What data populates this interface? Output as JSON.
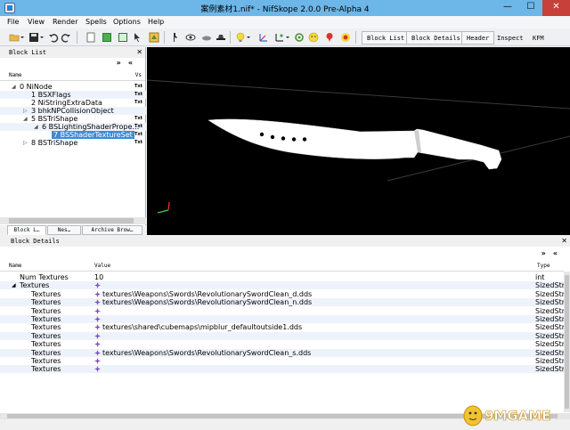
{
  "window": {
    "title": "案例素材1.nif* - NifSkope 2.0.0 Pre-Alpha 4",
    "minimize": "—",
    "maximize": "☐",
    "close": "✕"
  },
  "menu": [
    "File",
    "View",
    "Render",
    "Spells",
    "Options",
    "Help"
  ],
  "toolbar": {
    "tabs": [
      "Block List",
      "Block Details",
      "Header",
      "Inspect",
      "KFM"
    ]
  },
  "block_list": {
    "title": "Block List",
    "col_name": "Name",
    "col_version": "Vs",
    "rows": [
      {
        "label": "0 NiNode",
        "version": "Txt",
        "arrow": "◢"
      },
      {
        "label": "1 BSXFlags",
        "version": "Txt",
        "arrow": ""
      },
      {
        "label": "2 NiStringExtraData",
        "version": "Txt",
        "arrow": ""
      },
      {
        "label": "3 bhkNPCollisionObject",
        "version": "",
        "arrow": "▷"
      },
      {
        "label": "5 BSTriShape",
        "version": "Txt",
        "arrow": "◢"
      },
      {
        "label": "6 BSLightingShaderPrope…",
        "version": "Txt",
        "arrow": "◢"
      },
      {
        "label": "7 BSShaderTextureSet",
        "version": "Txt",
        "arrow": ""
      },
      {
        "label": "8 BSTriShape",
        "version": "Txt",
        "arrow": "▷"
      }
    ],
    "tabs": [
      "Block L…",
      "Nes…",
      "Archive Brow…"
    ]
  },
  "block_details": {
    "title": "Block Details",
    "col_name": "Name",
    "col_value": "Value",
    "col_type": "Type",
    "rows": [
      {
        "name": "Num Textures",
        "value": "10",
        "type": "int",
        "indent": 0,
        "icon": false
      },
      {
        "name": "Textures",
        "value": "",
        "type": "SizedStr",
        "indent": 0,
        "icon": true,
        "arrow": "◢"
      },
      {
        "name": "Textures",
        "value": "textures\\Weapons\\Swords\\RevolutionarySwordClean_d.dds",
        "type": "SizedStr",
        "indent": 1,
        "icon": true
      },
      {
        "name": "Textures",
        "value": "textures\\Weapons\\Swords\\RevolutionarySwordClean_n.dds",
        "type": "SizedStr",
        "indent": 1,
        "icon": true
      },
      {
        "name": "Textures",
        "value": "",
        "type": "SizedStr",
        "indent": 1,
        "icon": true
      },
      {
        "name": "Textures",
        "value": "",
        "type": "SizedStr",
        "indent": 1,
        "icon": true
      },
      {
        "name": "Textures",
        "value": "textures\\shared\\cubemaps\\mipblur_defaultoutside1.dds",
        "type": "SizedStr",
        "indent": 1,
        "icon": true
      },
      {
        "name": "Textures",
        "value": "",
        "type": "SizedStr",
        "indent": 1,
        "icon": true
      },
      {
        "name": "Textures",
        "value": "",
        "type": "SizedStr",
        "indent": 1,
        "icon": true
      },
      {
        "name": "Textures",
        "value": "textures\\Weapons\\Swords\\RevolutionarySwordClean_s.dds",
        "type": "SizedStr",
        "indent": 1,
        "icon": true
      },
      {
        "name": "Textures",
        "value": "",
        "type": "SizedStr",
        "indent": 1,
        "icon": true
      },
      {
        "name": "Textures",
        "value": "",
        "type": "SizedStr",
        "indent": 1,
        "icon": true
      }
    ]
  },
  "watermark": {
    "text": "9MGAME"
  },
  "colors": {
    "selection": "#3b8bd8",
    "titlebar": "#6db6e8",
    "close": "#c7403a"
  }
}
